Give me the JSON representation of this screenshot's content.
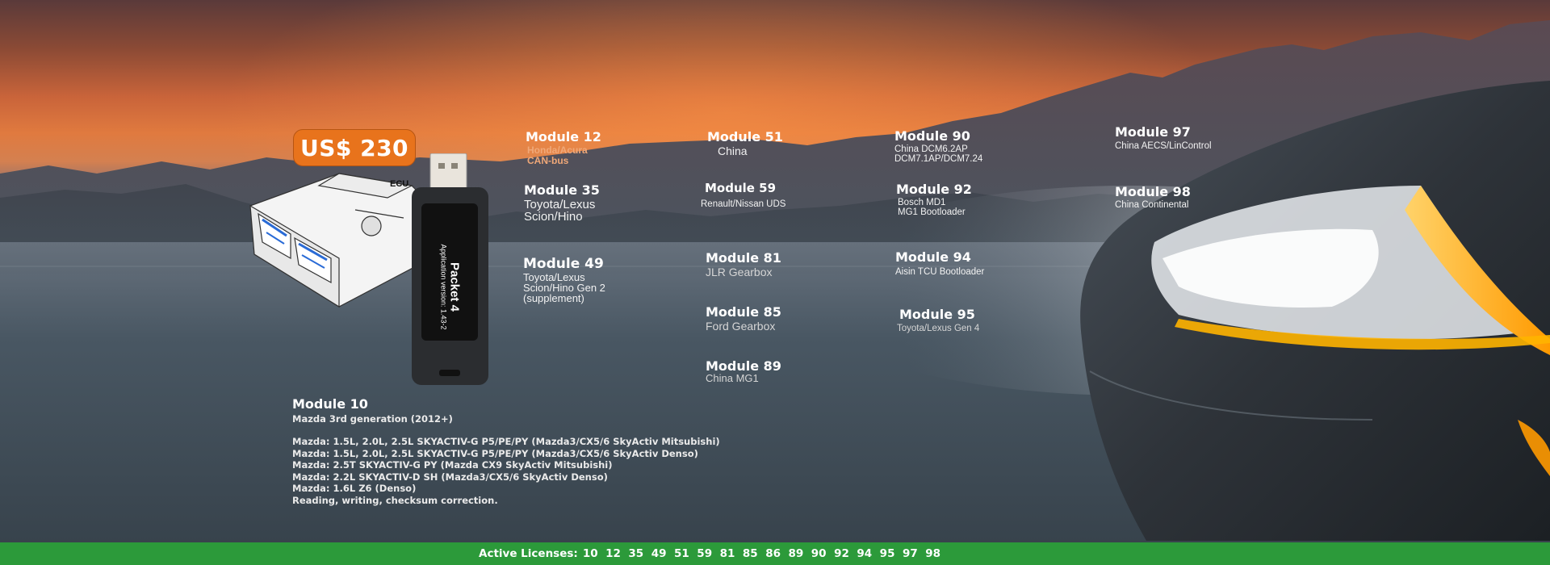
{
  "price": "US$ 230",
  "product": {
    "name": "Packet 4",
    "version": "Application version: 1.43-2",
    "ecu_label": "ECU"
  },
  "modules": {
    "m12": {
      "title": "Module 12",
      "lines": [
        "Honda/Acura",
        "CAN-bus"
      ]
    },
    "m35": {
      "title": "Module 35",
      "lines": [
        "Toyota/Lexus",
        "Scion/Hino"
      ]
    },
    "m49": {
      "title": "Module 49",
      "lines": [
        "Toyota/Lexus",
        "Scion/Hino Gen 2",
        "(supplement)"
      ]
    },
    "m51": {
      "title": "Module 51",
      "lines": [
        "China"
      ]
    },
    "m59": {
      "title": "Module 59",
      "lines": [
        "Renault/Nissan UDS"
      ]
    },
    "m81": {
      "title": "Module 81",
      "lines": [
        "JLR Gearbox"
      ]
    },
    "m85": {
      "title": "Module 85",
      "lines": [
        "Ford Gearbox"
      ]
    },
    "m89": {
      "title": "Module 89",
      "lines": [
        "China MG1"
      ]
    },
    "m90": {
      "title": "Module 90",
      "lines": [
        "China DCM6.2AP",
        "DCM7.1AP/DCM7.24"
      ]
    },
    "m92": {
      "title": "Module 92",
      "lines": [
        "Bosch MD1",
        "MG1 Bootloader"
      ]
    },
    "m94": {
      "title": "Module 94",
      "lines": [
        "Aisin TCU Bootloader"
      ]
    },
    "m95": {
      "title": "Module 95",
      "lines": [
        "Toyota/Lexus Gen 4"
      ]
    },
    "m97": {
      "title": "Module 97",
      "lines": [
        "China AECS/LinControl"
      ]
    },
    "m98": {
      "title": "Module 98",
      "lines": [
        "China Continental"
      ]
    }
  },
  "module10": {
    "title": "Module 10",
    "subtitle": "Mazda 3rd generation (2012+)",
    "lines": [
      "Mazda: 1.5L, 2.0L, 2.5L SKYACTIV-G P5/PE/PY (Mazda3/CX5/6 SkyActiv Mitsubishi)",
      "Mazda: 1.5L, 2.0L, 2.5L SKYACTIV-G P5/PE/PY (Mazda3/CX5/6 SkyActiv Denso)",
      "Mazda: 2.5T SKYACTIV-G PY (Mazda CX9 SkyActiv Mitsubishi)",
      "Mazda: 2.2L SKYACTIV-D SH (Mazda3/CX5/6 SkyActiv Denso)",
      "Mazda: 1.6L Z6 (Denso)",
      "Reading, writing, checksum correction."
    ]
  },
  "footer": {
    "label": "Active Licenses:",
    "licenses": [
      "10",
      "12",
      "35",
      "49",
      "51",
      "59",
      "81",
      "85",
      "86",
      "89",
      "90",
      "92",
      "94",
      "95",
      "97",
      "98"
    ]
  },
  "colors": {
    "badge": "#e8731c",
    "footer": "#2c9a3a",
    "headlight": "#ffb400"
  }
}
